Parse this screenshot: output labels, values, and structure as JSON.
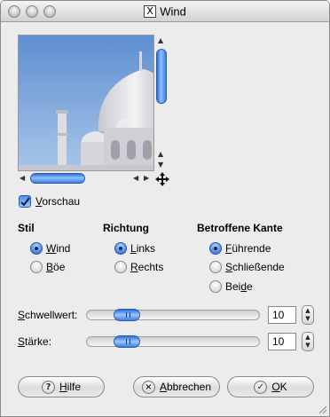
{
  "window": {
    "title": "Wind",
    "title_icon": "X"
  },
  "preview": {
    "checkbox_label_mnemonic": "V",
    "checkbox_label_rest": "orschau",
    "checked": true
  },
  "groups": {
    "stil": {
      "heading": "Stil",
      "options": [
        {
          "mn": "W",
          "rest": "ind",
          "pre": "",
          "selected": true
        },
        {
          "mn": "B",
          "rest": "öe",
          "pre": "",
          "selected": false
        }
      ]
    },
    "richtung": {
      "heading": "Richtung",
      "options": [
        {
          "mn": "L",
          "rest": "inks",
          "pre": "",
          "selected": true
        },
        {
          "mn": "R",
          "rest": "echts",
          "pre": "",
          "selected": false
        }
      ]
    },
    "kante": {
      "heading": "Betroffene Kante",
      "options": [
        {
          "mn": "F",
          "rest": "ührende",
          "pre": "",
          "selected": true
        },
        {
          "mn": "S",
          "rest": "chließende",
          "pre": "",
          "selected": false
        },
        {
          "mn": "d",
          "rest": "e",
          "pre": "Bei",
          "selected": false
        }
      ]
    }
  },
  "sliders": [
    {
      "label_mn": "S",
      "label_rest": "chwellwert:",
      "value": "10",
      "fraction": 0.18
    },
    {
      "label_mn": "S",
      "label_rest": "tärke:",
      "value": "10",
      "fraction": 0.18
    }
  ],
  "buttons": {
    "help": {
      "mn": "H",
      "rest": "ilfe",
      "icon": "?"
    },
    "cancel": {
      "mn": "A",
      "rest": "bbrechen",
      "icon": "×"
    },
    "ok": {
      "mn": "O",
      "rest": "K",
      "icon": "✓"
    }
  },
  "colors": {
    "accent": "#3c7ee0",
    "sky": "#7aa7dd"
  }
}
